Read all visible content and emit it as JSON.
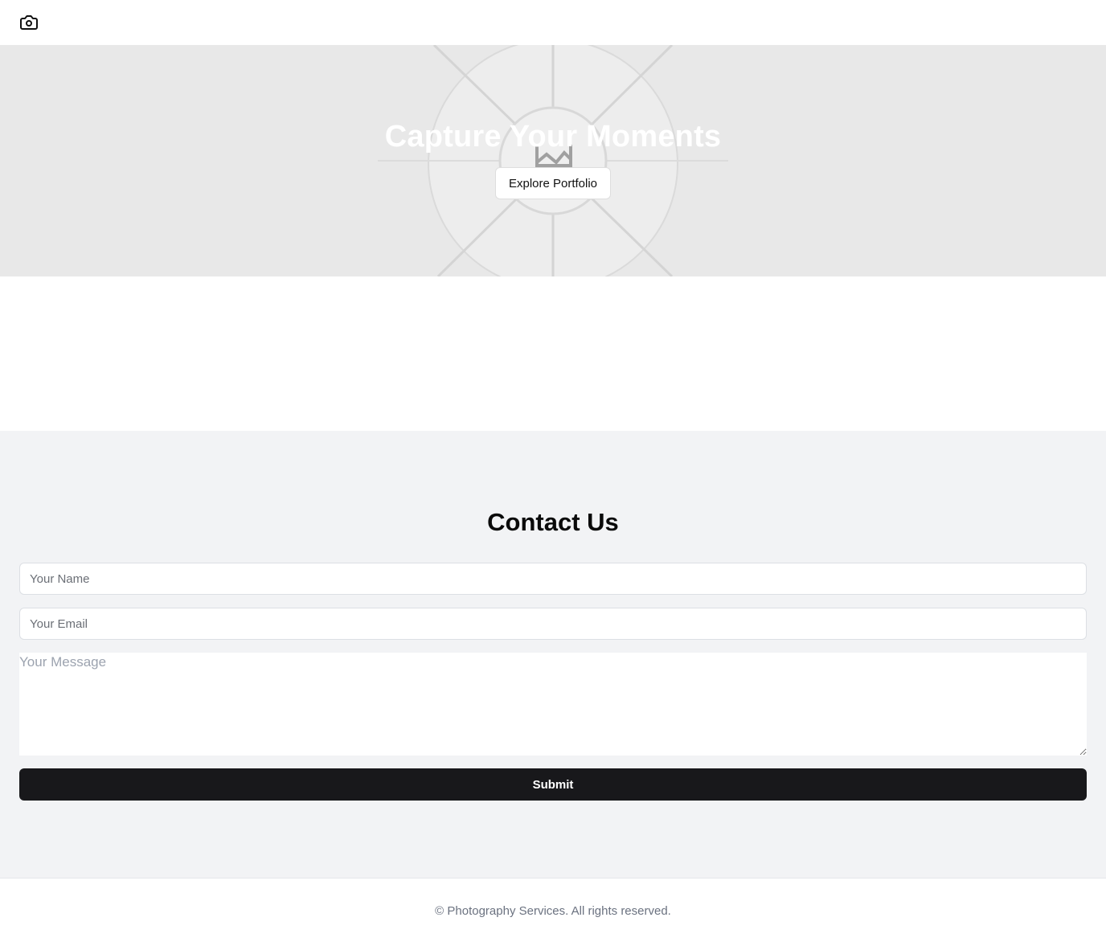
{
  "header": {
    "logo_icon": "camera-icon"
  },
  "hero": {
    "title": "Capture Your Moments",
    "button_label": "Explore Portfolio",
    "image_icon": "image-placeholder-icon"
  },
  "contact": {
    "title": "Contact Us",
    "name_placeholder": "Your Name",
    "email_placeholder": "Your Email",
    "message_placeholder": "Your Message",
    "submit_label": "Submit"
  },
  "footer": {
    "text": "© Photography Services. All rights reserved."
  },
  "colors": {
    "hero_bg": "#e8e8e8",
    "contact_bg": "#f2f3f5",
    "submit_bg": "#18181b",
    "footer_text": "#6b7280"
  }
}
